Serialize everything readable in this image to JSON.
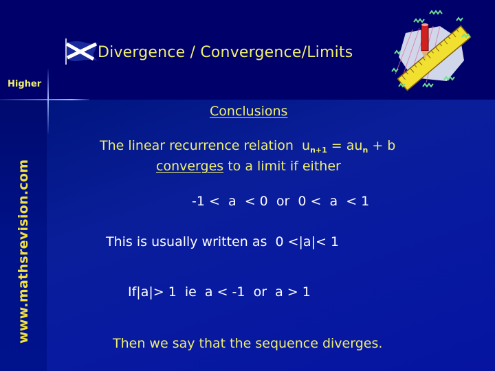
{
  "header": {
    "title": "Divergence / Convergence/Limits",
    "level": "Higher",
    "flag_icon": "scottish-saltire-flag",
    "clipart_icon": "pencil-ruler-clipart"
  },
  "sidebar": {
    "website": "www.mathsrevision.com"
  },
  "main": {
    "heading": "Conclusions",
    "relation_intro": "The linear recurrence relation",
    "relation_u": "u",
    "relation_sub1": "n+1",
    "relation_mid": " = au",
    "relation_sub2": "n",
    "relation_end": " + b",
    "converges_word": "converges",
    "converges_rest": " to a limit if either",
    "condition": "-1 <  a  < 0  or  0 <  a  < 1",
    "usually_written": "This is usually written as  0 <|a|< 1",
    "diverge_condition": "If|a|> 1  ie  a < -1  or  a > 1",
    "conclusion": "Then we say that the sequence diverges."
  },
  "colors": {
    "background": "#00006a",
    "title_yellow": "#f0f070",
    "body_white": "#ffffff"
  }
}
